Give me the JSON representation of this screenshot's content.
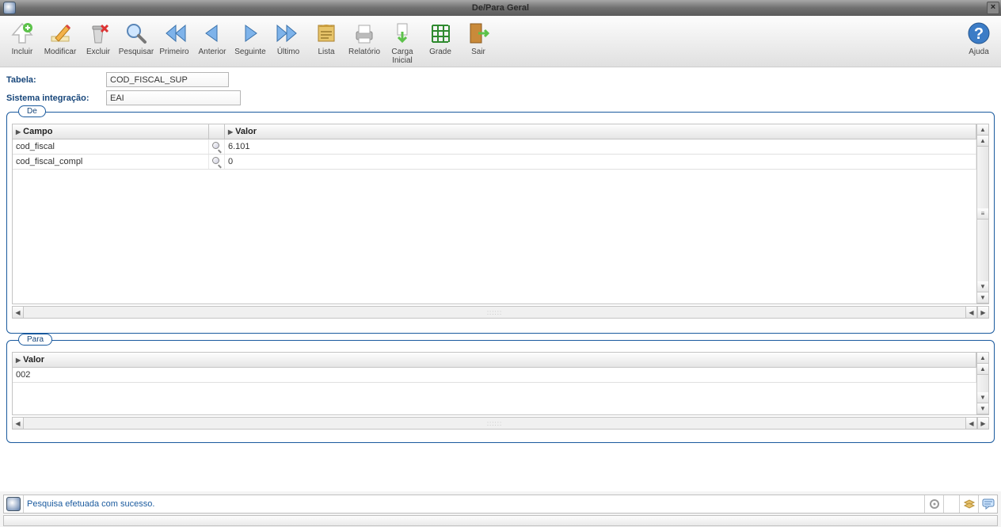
{
  "window": {
    "title": "De/Para Geral"
  },
  "toolbar": {
    "incluir": "Incluir",
    "modificar": "Modificar",
    "excluir": "Excluir",
    "pesquisar": "Pesquisar",
    "primeiro": "Primeiro",
    "anterior": "Anterior",
    "seguinte": "Seguinte",
    "ultimo": "Último",
    "lista": "Lista",
    "relatorio": "Relatório",
    "carga_inicial": "Carga\nInicial",
    "grade": "Grade",
    "sair": "Sair",
    "ajuda": "Ajuda"
  },
  "form": {
    "tabela_label": "Tabela:",
    "tabela_value": "COD_FISCAL_SUP",
    "sistema_label": "Sistema integração:",
    "sistema_value": "EAI"
  },
  "groups": {
    "de": "De",
    "para": "Para"
  },
  "de_table": {
    "headers": {
      "campo": "Campo",
      "valor": "Valor"
    },
    "rows": [
      {
        "campo": "cod_fiscal",
        "valor": "6.101"
      },
      {
        "campo": "cod_fiscal_compl",
        "valor": "0"
      }
    ]
  },
  "para_table": {
    "headers": {
      "valor": "Valor"
    },
    "rows": [
      {
        "valor": "002"
      }
    ]
  },
  "status": {
    "message": "Pesquisa efetuada com sucesso."
  }
}
